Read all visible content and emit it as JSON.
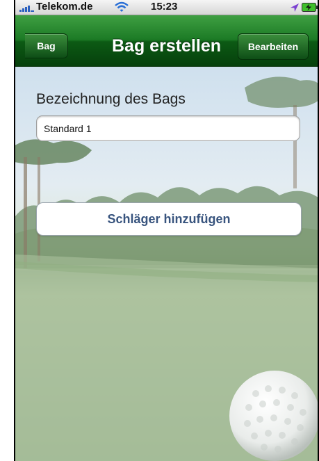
{
  "status_bar": {
    "carrier": "Telekom.de",
    "time": "15:23"
  },
  "nav": {
    "back_label": "Bag",
    "title": "Bag erstellen",
    "edit_label": "Bearbeiten",
    "color": "#1c7a25"
  },
  "form": {
    "heading": "Bezeichnung des Bags",
    "name_value": "Standard 1",
    "add_button_label": "Schläger hinzufügen",
    "button_text_color": "#38547e"
  },
  "icons": [
    "signal-bars-icon",
    "wifi-icon",
    "location-arrow-icon",
    "battery-charging-icon"
  ]
}
